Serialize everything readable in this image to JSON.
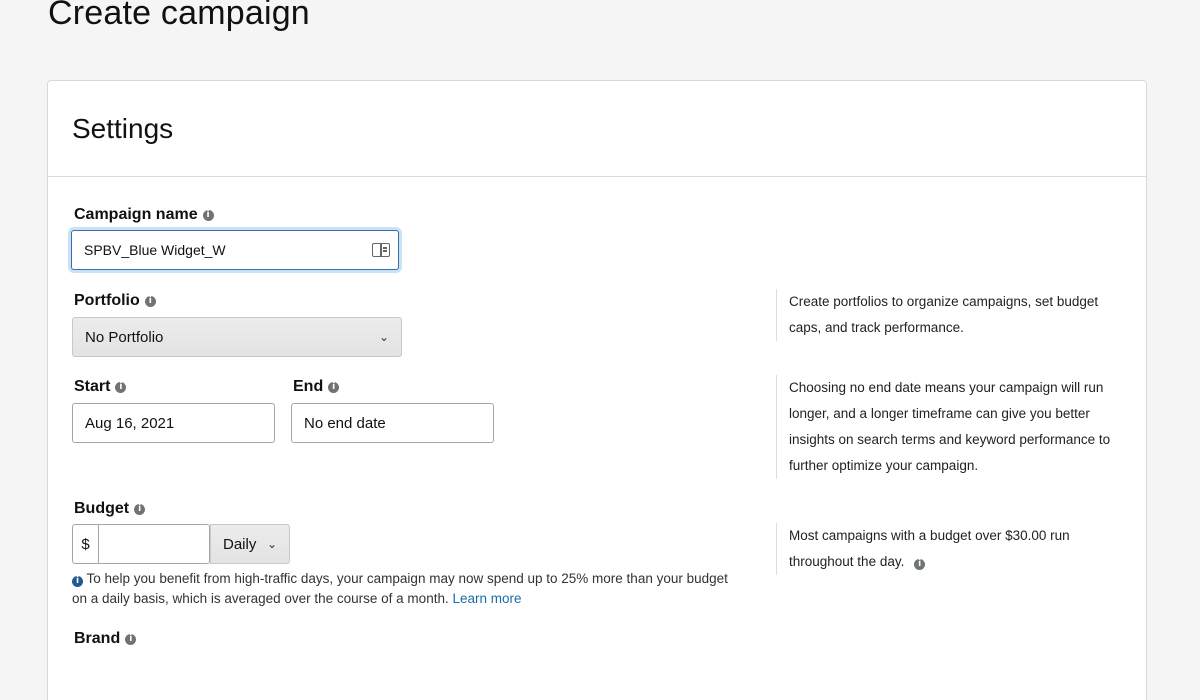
{
  "page": {
    "title": "Create campaign"
  },
  "settings": {
    "title": "Settings",
    "campaign_name": {
      "label": "Campaign name",
      "value": "SPBV_Blue Widget_W"
    },
    "portfolio": {
      "label": "Portfolio",
      "selected": "No Portfolio",
      "note": "Create portfolios to organize campaigns, set budget caps, and track performance."
    },
    "start": {
      "label": "Start",
      "value": "Aug 16, 2021"
    },
    "end": {
      "label": "End",
      "value": "No end date"
    },
    "dates_note": "Choosing no end date means your campaign will run longer, and a longer timeframe can give you better insights on search terms and keyword performance to further optimize your campaign.",
    "budget": {
      "label": "Budget",
      "currency": "$",
      "value": "",
      "period": "Daily",
      "help_text": "To help you benefit from high-traffic days, your campaign may now spend up to 25% more than your budget on a daily basis, which is averaged over the course of a month.",
      "learn_more": "Learn more",
      "note": "Most campaigns with a budget over $30.00 run throughout the day."
    },
    "brand": {
      "label": "Brand"
    }
  },
  "icons": {
    "info": "info-icon",
    "book": "book-icon",
    "chevron": "chevron-down-icon"
  }
}
